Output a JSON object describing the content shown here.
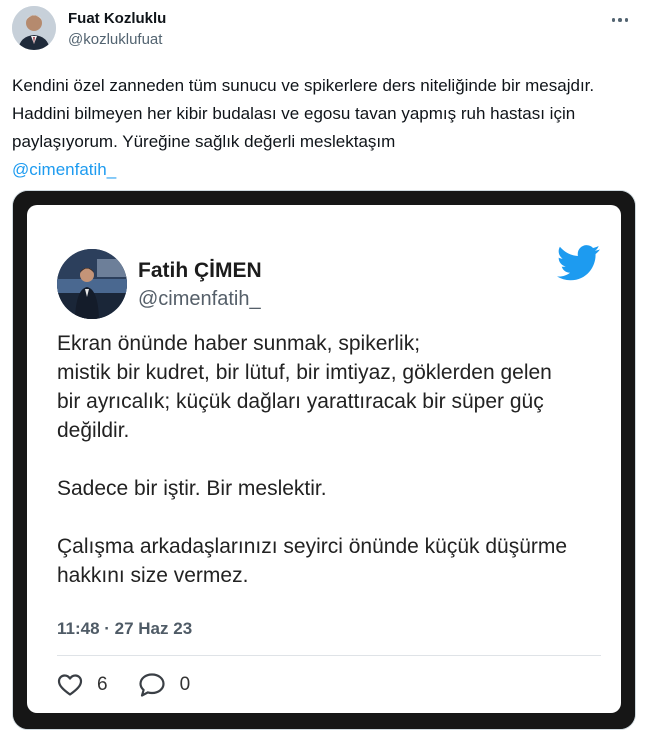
{
  "post": {
    "author_name": "Fuat Kozluklu",
    "author_handle": "@kozluklufuat",
    "body": "Kendini özel zanneden tüm sunucu ve spikerlere ders niteliğinde bir mesajdır. Haddini bilmeyen her kibir budalası ve egosu tavan yapmış ruh hastası için paylaşıyorum. Yüreğine sağlık değerli meslektaşım",
    "mention": "@cimenfatih_"
  },
  "embedded": {
    "name": "Fatih ÇİMEN",
    "handle": "@cimenfatih_",
    "paragraphs": [
      {
        "lines": [
          "Ekran önünde haber sunmak, spikerlik;",
          "mistik bir kudret, bir lütuf, bir imtiyaz, göklerden gelen",
          "bir ayrıcalık; küçük dağları yarattıracak bir süper güç",
          "değildir."
        ]
      },
      {
        "lines": [
          "Sadece bir iştir. Bir meslektir."
        ]
      },
      {
        "lines": [
          "Çalışma arkadaşlarınızı seyirci önünde küçük düşürme",
          "hakkını size vermez."
        ]
      }
    ],
    "timestamp": "11:48 · 27 Haz 23",
    "likes": "6",
    "replies": "0"
  },
  "icons": {
    "more": "more-icon",
    "twitter": "twitter-bird-icon",
    "like": "heart-icon",
    "reply": "reply-icon"
  },
  "colors": {
    "accent": "#1d9bf0",
    "text": "#0f1419",
    "muted": "#536471"
  }
}
